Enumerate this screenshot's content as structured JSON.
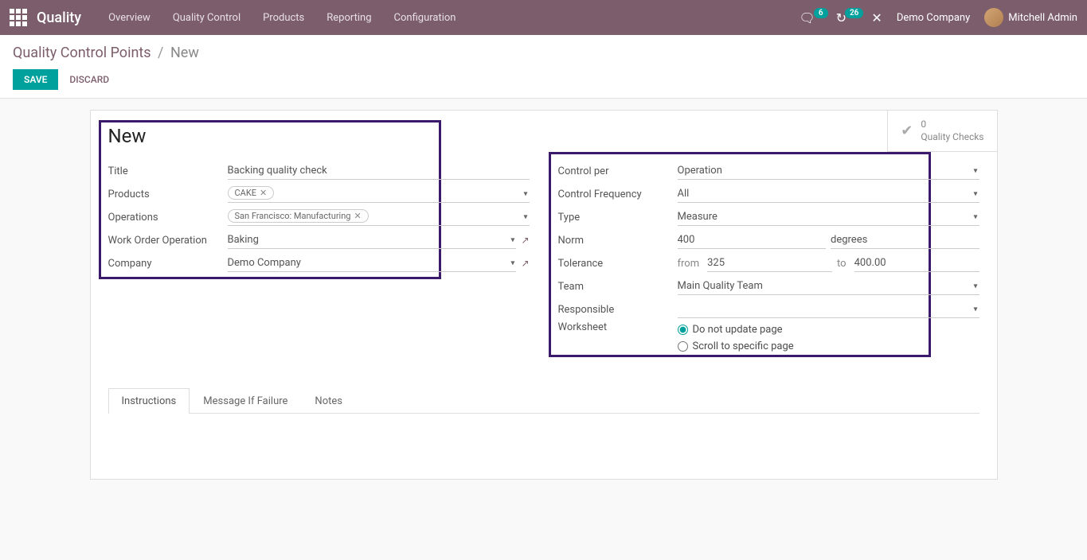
{
  "navbar": {
    "brand": "Quality",
    "menu": [
      "Overview",
      "Quality Control",
      "Products",
      "Reporting",
      "Configuration"
    ],
    "messages_badge": "6",
    "activities_badge": "26",
    "company": "Demo Company",
    "user": "Mitchell Admin"
  },
  "breadcrumb": {
    "parent": "Quality Control Points",
    "current": "New"
  },
  "actions": {
    "save": "SAVE",
    "discard": "DISCARD"
  },
  "stat": {
    "count": "0",
    "label": "Quality Checks"
  },
  "form": {
    "title": "New",
    "left": {
      "title_label": "Title",
      "title_value": "Backing quality check",
      "products_label": "Products",
      "products_tag": "CAKE",
      "operations_label": "Operations",
      "operations_tag": "San Francisco: Manufacturing",
      "wo_label": "Work Order Operation",
      "wo_value": "Baking",
      "company_label": "Company",
      "company_value": "Demo Company"
    },
    "right": {
      "control_per_label": "Control per",
      "control_per_value": "Operation",
      "freq_label": "Control Frequency",
      "freq_value": "All",
      "type_label": "Type",
      "type_value": "Measure",
      "norm_label": "Norm",
      "norm_value": "400",
      "norm_unit": "degrees",
      "tol_label": "Tolerance",
      "tol_from_lbl": "from",
      "tol_from": "325",
      "tol_to_lbl": "to",
      "tol_to": "400.00",
      "team_label": "Team",
      "team_value": "Main Quality Team",
      "responsible_label": "Responsible",
      "responsible_value": "",
      "worksheet_label": "Worksheet",
      "ws_opt1": "Do not update page",
      "ws_opt2": "Scroll to specific page"
    }
  },
  "tabs": [
    "Instructions",
    "Message If Failure",
    "Notes"
  ]
}
